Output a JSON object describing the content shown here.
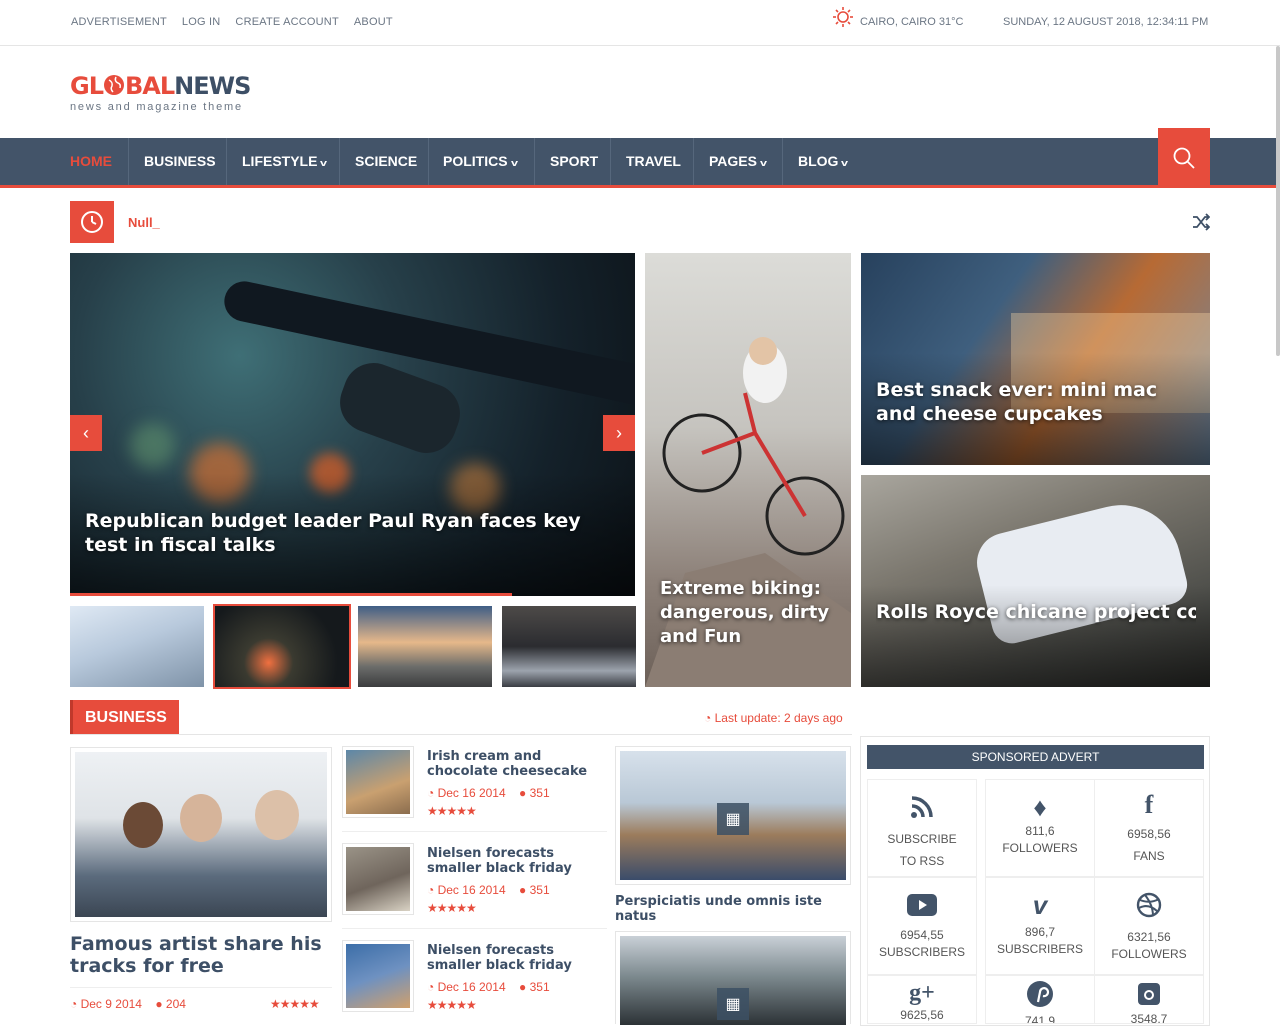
{
  "topbar": {
    "links": [
      "ADVERTISEMENT",
      "LOG IN",
      "CREATE ACCOUNT",
      "ABOUT"
    ],
    "weather": "CAIRO, CAIRO 31°C",
    "datetime": "SUNDAY, 12 AUGUST 2018, 12:34:11 PM"
  },
  "logo": {
    "part1": "GL",
    "part2": "BAL",
    "part3": "NEWS",
    "tagline": "news and magazine theme"
  },
  "nav": {
    "items": [
      {
        "label": "HOME",
        "dropdown": false,
        "active": true
      },
      {
        "label": "BUSINESS",
        "dropdown": false
      },
      {
        "label": "LIFESTYLE",
        "dropdown": true
      },
      {
        "label": "SCIENCE",
        "dropdown": false
      },
      {
        "label": "POLITICS",
        "dropdown": true
      },
      {
        "label": "SPORT",
        "dropdown": false
      },
      {
        "label": "TRAVEL",
        "dropdown": false
      },
      {
        "label": "PAGES",
        "dropdown": true
      },
      {
        "label": "BLOG",
        "dropdown": true
      }
    ]
  },
  "ticker": {
    "text": "Null_"
  },
  "slider": {
    "caption": "Republican budget leader Paul Ryan faces key test in fiscal talks",
    "prev": "‹",
    "next": "›"
  },
  "features": {
    "biking": "Extreme biking: dangerous, dirty and Fun",
    "snack": "Best snack ever: mini mac and cheese cupcakes",
    "rolls": "Rolls Royce chicane project coupé will terrify continents"
  },
  "business": {
    "title": "BUSINESS",
    "last_update": "Last update: 2 days ago",
    "lead": {
      "title": "Famous artist share his tracks for free",
      "date": "Dec 9 2014",
      "comments": "204",
      "stars": "★★★★★"
    },
    "list": [
      {
        "title": "Irish cream and chocolate cheesecake",
        "date": "Dec 16 2014",
        "comments": "351",
        "stars": "★★★★★"
      },
      {
        "title": "Nielsen forecasts smaller black friday",
        "date": "Dec 16 2014",
        "comments": "351",
        "stars": "★★★★★"
      },
      {
        "title": "Nielsen forecasts smaller black friday",
        "date": "Dec 16 2014",
        "comments": "351",
        "stars": "★★★★★"
      }
    ],
    "video1_title": "Perspiciatis unde omnis iste natus"
  },
  "sidebar": {
    "heading": "SPONSORED ADVERT",
    "social": [
      {
        "icon": "rss-icon",
        "line1": "SUBSCRIBE",
        "line2": "TO RSS"
      },
      {
        "icon": "twitter-icon",
        "line1": "811,6",
        "line2": "FOLLOWERS"
      },
      {
        "icon": "facebook-icon",
        "line1": "6958,56",
        "line2": "FANS"
      },
      {
        "icon": "youtube-icon",
        "line1": "6954,55",
        "line2": "SUBSCRIBERS"
      },
      {
        "icon": "vimeo-icon",
        "line1": "896,7",
        "line2": "SUBSCRIBERS"
      },
      {
        "icon": "dribbble-icon",
        "line1": "6321,56",
        "line2": "FOLLOWERS"
      },
      {
        "icon": "google-plus-icon",
        "line1": "9625,56",
        "line2": ""
      },
      {
        "icon": "pinterest-icon",
        "line1": "741,9",
        "line2": ""
      },
      {
        "icon": "instagram-icon",
        "line1": "3548,7",
        "line2": ""
      }
    ]
  },
  "colors": {
    "accent": "#e74c3c",
    "nav": "#435469",
    "brand_dark": "#3d4f66"
  }
}
